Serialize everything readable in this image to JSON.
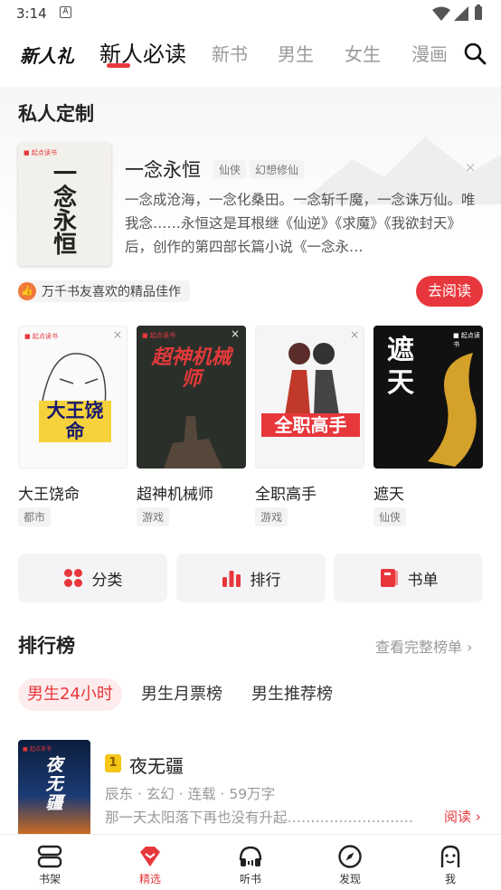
{
  "status": {
    "time": "3:14"
  },
  "nav": {
    "tabs": [
      {
        "label": "新人礼"
      },
      {
        "label": "新人必读"
      },
      {
        "label": "新书"
      },
      {
        "label": "男生"
      },
      {
        "label": "女生"
      },
      {
        "label": "漫画"
      }
    ]
  },
  "custom": {
    "section_title": "私人定制",
    "book": {
      "title": "一念永恒",
      "tags": [
        "仙侠",
        "幻想修仙"
      ],
      "desc": "一念成沧海，一念化桑田。一念斩千魔，一念诛万仙。唯我念……永恒这是耳根继《仙逆》《求魔》《我欲封天》后，创作的第四部长篇小说《一念永…",
      "badge": "万千书友喜欢的精品佳作",
      "read_label": "去阅读",
      "cover_text": "一念永恒"
    }
  },
  "grid": [
    {
      "title": "大王饶命",
      "tag": "都市",
      "cover_text": "大王饶命"
    },
    {
      "title": "超神机械师",
      "tag": "游戏",
      "cover_text": "超神机械师"
    },
    {
      "title": "全职高手",
      "tag": "游戏",
      "cover_text": "全职高手"
    },
    {
      "title": "遮天",
      "tag": "仙侠",
      "cover_text": "遮天"
    }
  ],
  "quick": {
    "category": "分类",
    "rank": "排行",
    "booklist": "书单"
  },
  "ranking": {
    "title": "排行榜",
    "more": "查看完整榜单",
    "tabs": [
      "男生24小时",
      "男生月票榜",
      "男生推荐榜"
    ],
    "item": {
      "rank": "1",
      "title": "夜无疆",
      "author": "辰东",
      "genre": "玄幻",
      "status": "连载",
      "words": "59万字",
      "desc": "那一天太阳落下再也没有升起…………………………",
      "read": "阅读",
      "cover_text": "夜无疆"
    }
  },
  "bottomnav": [
    {
      "label": "书架",
      "icon": "bookshelf-icon"
    },
    {
      "label": "精选",
      "icon": "featured-icon"
    },
    {
      "label": "听书",
      "icon": "headphones-icon"
    },
    {
      "label": "发现",
      "icon": "compass-icon"
    },
    {
      "label": "我",
      "icon": "profile-icon"
    }
  ],
  "colors": {
    "accent": "#e8373c",
    "text": "#222222",
    "muted": "#999999"
  }
}
